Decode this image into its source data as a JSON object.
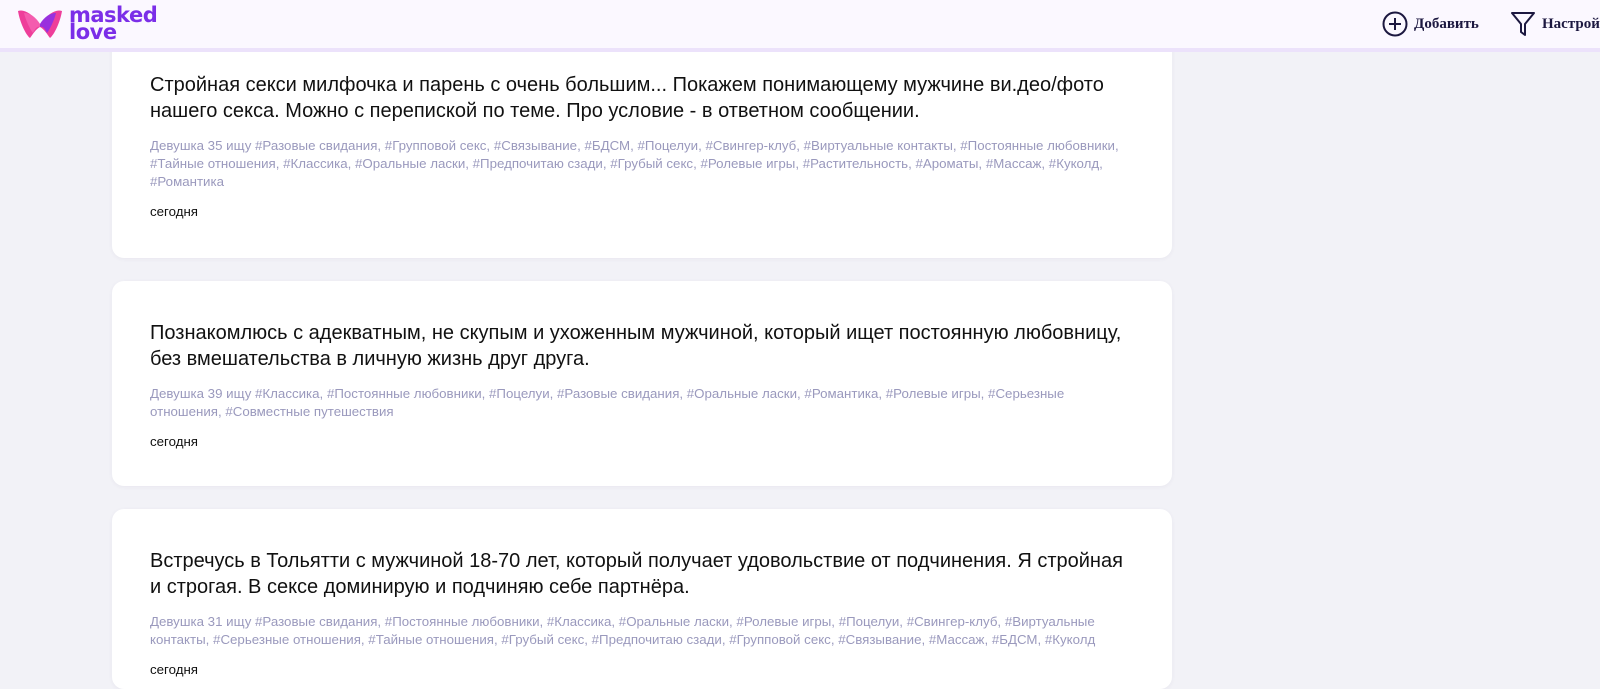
{
  "header": {
    "logo": {
      "line1": "masked",
      "line2": "love"
    },
    "add_label": "Добавить",
    "settings_label": "Настрой"
  },
  "colors": {
    "brand_purple": "#7b2ee8",
    "brand_pink": "#ee3e9a",
    "tags": "#9a99bd",
    "background": "#f2f2f7"
  },
  "icons": {
    "add": "plus-circle-icon",
    "settings": "filter-icon",
    "logo": "mask-logo-icon"
  },
  "ads": [
    {
      "title": "Стройная секси милфочка и парень с очень большим... Покажем понимающему мужчине ви.део/фото нашего секса. Можно с перепиской по теме. Про условие - в ответном сообщении.",
      "tags": "Девушка 35 ищу #Разовые свидания, #Групповой секс, #Связывание, #БДСМ, #Поцелуи, #Свингер-клуб, #Виртуальные контакты, #Постоянные любовники, #Тайные отношения, #Классика, #Оральные ласки, #Предпочитаю сзади, #Грубый секс, #Ролевые игры, #Растительность, #Ароматы, #Массаж, #Куколд, #Романтика",
      "date": "сегодня"
    },
    {
      "title": "Познакомлюсь с адекватным, не скупым и ухоженным мужчиной, который ищет постоянную любовницу, без вмешательства в личную жизнь друг друга.",
      "tags": "Девушка 39 ищу #Классика, #Постоянные любовники, #Поцелуи, #Разовые свидания, #Оральные ласки, #Романтика, #Ролевые игры, #Серьезные отношения, #Совместные путешествия",
      "date": "сегодня"
    },
    {
      "title": "Встречусь в Тольятти с мужчиной 18-70 лет, который получает удовольствие от подчинения. Я стройная и строгая. В сексе доминирую и подчиняю себе партнёра.",
      "tags": "Девушка 31 ищу #Разовые свидания, #Постоянные любовники, #Классика, #Оральные ласки, #Ролевые игры, #Поцелуи, #Свингер-клуб, #Виртуальные контакты, #Серьезные отношения, #Тайные отношения, #Грубый секс, #Предпочитаю сзади, #Групповой секс, #Связывание, #Массаж, #БДСМ, #Куколд",
      "date": "сегодня"
    }
  ]
}
